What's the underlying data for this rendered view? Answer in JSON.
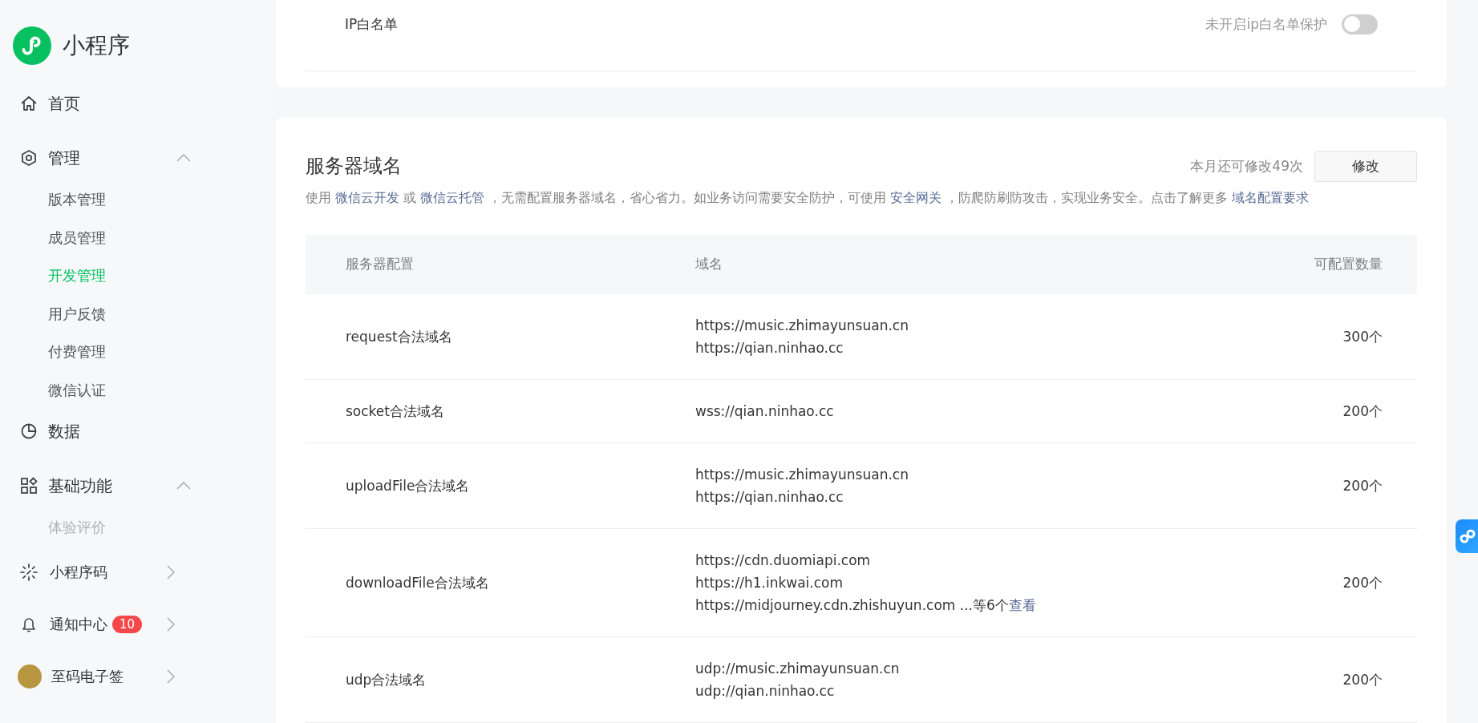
{
  "sidebar": {
    "logo_text": "小程序",
    "nav": [
      {
        "kind": "home",
        "label": "首页"
      },
      {
        "kind": "settings",
        "label": "管理",
        "expanded": true,
        "children": [
          {
            "label": "版本管理",
            "selected": false
          },
          {
            "label": "成员管理",
            "selected": false
          },
          {
            "label": "开发管理",
            "selected": true
          },
          {
            "label": "用户反馈",
            "selected": false
          },
          {
            "label": "付费管理",
            "selected": false
          },
          {
            "label": "微信认证",
            "selected": false
          }
        ]
      },
      {
        "kind": "chart",
        "label": "数据"
      },
      {
        "kind": "grid",
        "label": "基础功能",
        "expanded": true,
        "children": [
          {
            "label": "体验评价",
            "selected": false
          }
        ]
      }
    ],
    "bottom": [
      {
        "kind": "sparkle",
        "label": "小程序码"
      },
      {
        "kind": "bell",
        "label": "通知中心",
        "badge": "10"
      },
      {
        "kind": "avatar",
        "label": "至码电子签"
      }
    ]
  },
  "ip_whitelist": {
    "label": "IP白名单",
    "status": "未开启ip白名单保护",
    "on": false
  },
  "server_domains": {
    "title": "服务器域名",
    "quota": "本月还可修改49次",
    "edit_button": "修改",
    "description": [
      {
        "text": "使用 ",
        "link": false
      },
      {
        "text": "微信云开发",
        "link": true
      },
      {
        "text": " 或 ",
        "link": false
      },
      {
        "text": "微信云托管",
        "link": true
      },
      {
        "text": " ，无需配置服务器域名，省心省力。如业务访问需要安全防护，可使用 ",
        "link": false
      },
      {
        "text": "安全网关",
        "link": true
      },
      {
        "text": " ，防爬防刷防攻击，实现业务安全。点击了解更多 ",
        "link": false
      },
      {
        "text": "域名配置要求",
        "link": true
      }
    ],
    "columns": [
      "服务器配置",
      "域名",
      "可配置数量"
    ],
    "rows": [
      {
        "name": "request合法域名",
        "domains": [
          "https://music.zhimayunsuan.cn",
          "https://qian.ninhao.cc"
        ],
        "count": "300个"
      },
      {
        "name": "socket合法域名",
        "domains": [
          "wss://qian.ninhao.cc"
        ],
        "count": "200个"
      },
      {
        "name": "uploadFile合法域名",
        "domains": [
          "https://music.zhimayunsuan.cn",
          "https://qian.ninhao.cc"
        ],
        "count": "200个"
      },
      {
        "name": "downloadFile合法域名",
        "domains": [
          "https://cdn.duomiapi.com",
          "https://h1.inkwai.com",
          "https://midjourney.cdn.zhishuyun.com"
        ],
        "more_text": " ...等6个",
        "more_link": "查看",
        "count": "200个"
      },
      {
        "name": "udp合法域名",
        "domains": [
          "udp://music.zhimayunsuan.cn",
          "udp://qian.ninhao.cc"
        ],
        "count": "200个"
      }
    ]
  }
}
